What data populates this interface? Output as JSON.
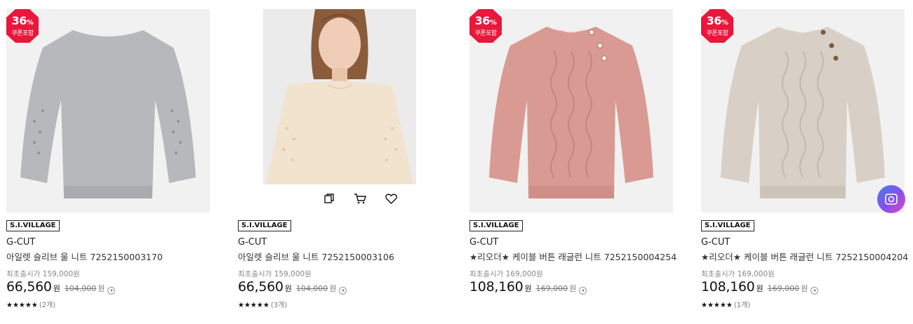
{
  "colors": {
    "badge_red": "#e8173b",
    "text": "#111111",
    "muted": "#888888"
  },
  "products": [
    {
      "badge": {
        "percent": "36",
        "percent_unit": "%",
        "coupon": "쿠폰포함"
      },
      "brand_tag": "S.I.VILLAGE",
      "maker": "G-CUT",
      "title": "아일렛 슬리브 울 니트 7252150003170",
      "original_price_text": "최초출시가 159,000원",
      "price": "66,560",
      "price_unit": "원",
      "list_price": "104,000",
      "list_price_unit": "원",
      "stars": "★★★★★",
      "review_count": "(2개)",
      "image": {
        "subject": "gray eyelet sleeve sweater",
        "color": "#b6b8bb"
      }
    },
    {
      "brand_tag": "S.I.VILLAGE",
      "maker": "G-CUT",
      "title": "아일렛 슬리브 울 니트 7252150003106",
      "original_price_text": "최초출시가 159,000원",
      "price": "66,560",
      "price_unit": "원",
      "list_price": "104,000",
      "list_price_unit": "원",
      "stars": "★★★★★",
      "review_count": "(3개)",
      "image": {
        "subject": "model wearing cream eyelet sweater",
        "color": "#f2e3cf"
      },
      "hover_icons": [
        "copy-icon",
        "cart-icon",
        "heart-icon"
      ]
    },
    {
      "badge": {
        "percent": "36",
        "percent_unit": "%",
        "coupon": "쿠폰포함"
      },
      "brand_tag": "S.I.VILLAGE",
      "maker": "G-CUT",
      "title": "★리오더★ 케이블 버튼 래글런 니트 7252150004254",
      "original_price_text": "최초출시가 169,000원",
      "price": "108,160",
      "price_unit": "원",
      "list_price": "169,000",
      "list_price_unit": "원",
      "image": {
        "subject": "pink cable knit raglan sweater",
        "color": "#d99a93"
      }
    },
    {
      "badge": {
        "percent": "36",
        "percent_unit": "%",
        "coupon": "쿠폰포함"
      },
      "brand_tag": "S.I.VILLAGE",
      "maker": "G-CUT",
      "title": "★리오더★ 케이블 버튼 래글런 니트 7252150004204",
      "original_price_text": "최초출시가 169,000원",
      "price": "108,160",
      "price_unit": "원",
      "list_price": "169,000",
      "list_price_unit": "원",
      "stars": "★★★★★",
      "review_count": "(1개)",
      "image": {
        "subject": "oatmeal cable knit raglan sweater",
        "color": "#d8d0c6"
      },
      "floating_button": "camera-search-icon"
    }
  ]
}
